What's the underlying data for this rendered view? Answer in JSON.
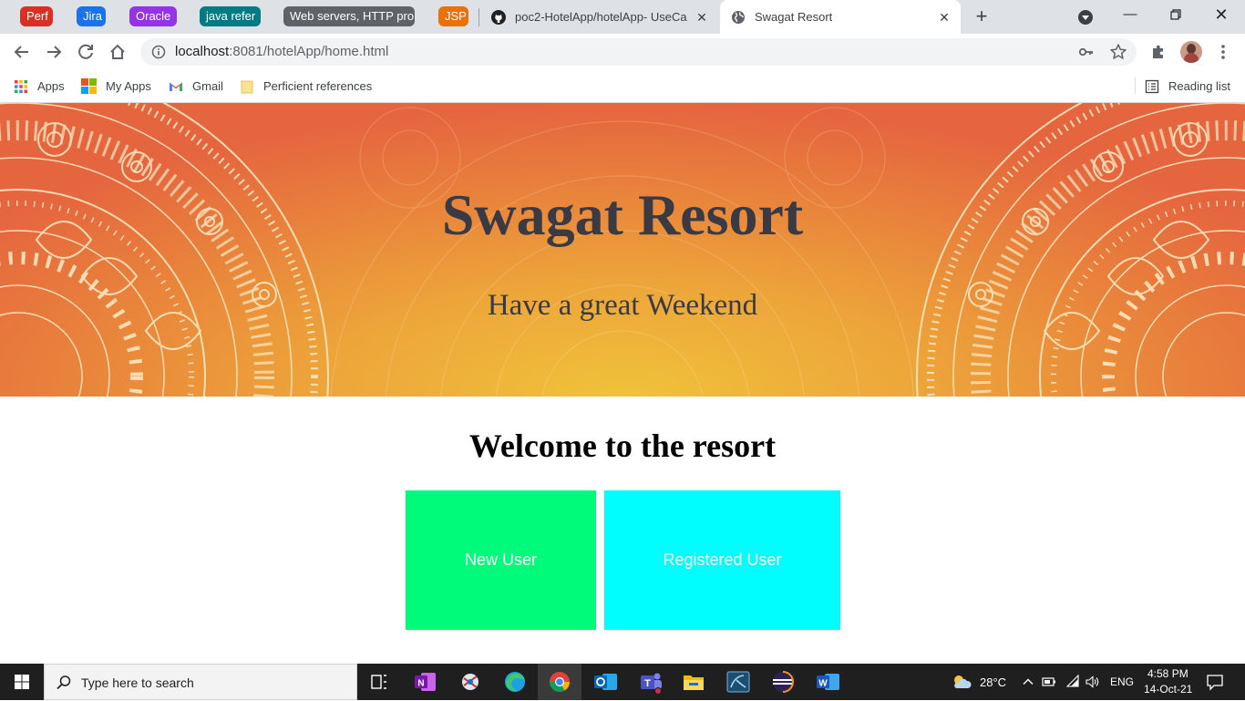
{
  "browser": {
    "tab_groups": [
      {
        "label": "Perf",
        "color": "#d93025"
      },
      {
        "label": "Jira",
        "color": "#1a73e8"
      },
      {
        "label": "Oracle",
        "color": "#9334e6"
      },
      {
        "label": "java refer",
        "color": "#007b83"
      },
      {
        "label": "Web servers, HTTP pro",
        "color": "#5f6368"
      },
      {
        "label": "JSP",
        "color": "#e8710a"
      }
    ],
    "tabs": [
      {
        "title": "poc2-HotelApp/hotelApp- UseCa",
        "icon": "github-icon"
      },
      {
        "title": "Swagat Resort",
        "icon": "globe-icon",
        "active": true
      }
    ],
    "address_host": "localhost",
    "address_path": ":8081/hotelApp/home.html",
    "bookmarks": [
      {
        "label": "Apps",
        "icon": "apps-grid-icon"
      },
      {
        "label": "My Apps",
        "icon": "microsoft-icon"
      },
      {
        "label": "Gmail",
        "icon": "gmail-icon"
      },
      {
        "label": "Perficient references",
        "icon": "folder-icon"
      }
    ],
    "reading_list": "Reading list"
  },
  "page": {
    "hero_title": "Swagat Resort",
    "hero_subtitle": "Have a great Weekend",
    "welcome_heading": "Welcome to the resort",
    "new_user_label": "New User",
    "registered_user_label": "Registered User",
    "colors": {
      "new_user_bg": "#00fa7a",
      "registered_user_bg": "#00fefe",
      "hero_center": "#f0c23a",
      "hero_edge": "#e5653f"
    }
  },
  "taskbar": {
    "search_placeholder": "Type here to search",
    "weather": "28°C",
    "language": "ENG",
    "time": "4:58 PM",
    "date": "14-Oct-21"
  }
}
